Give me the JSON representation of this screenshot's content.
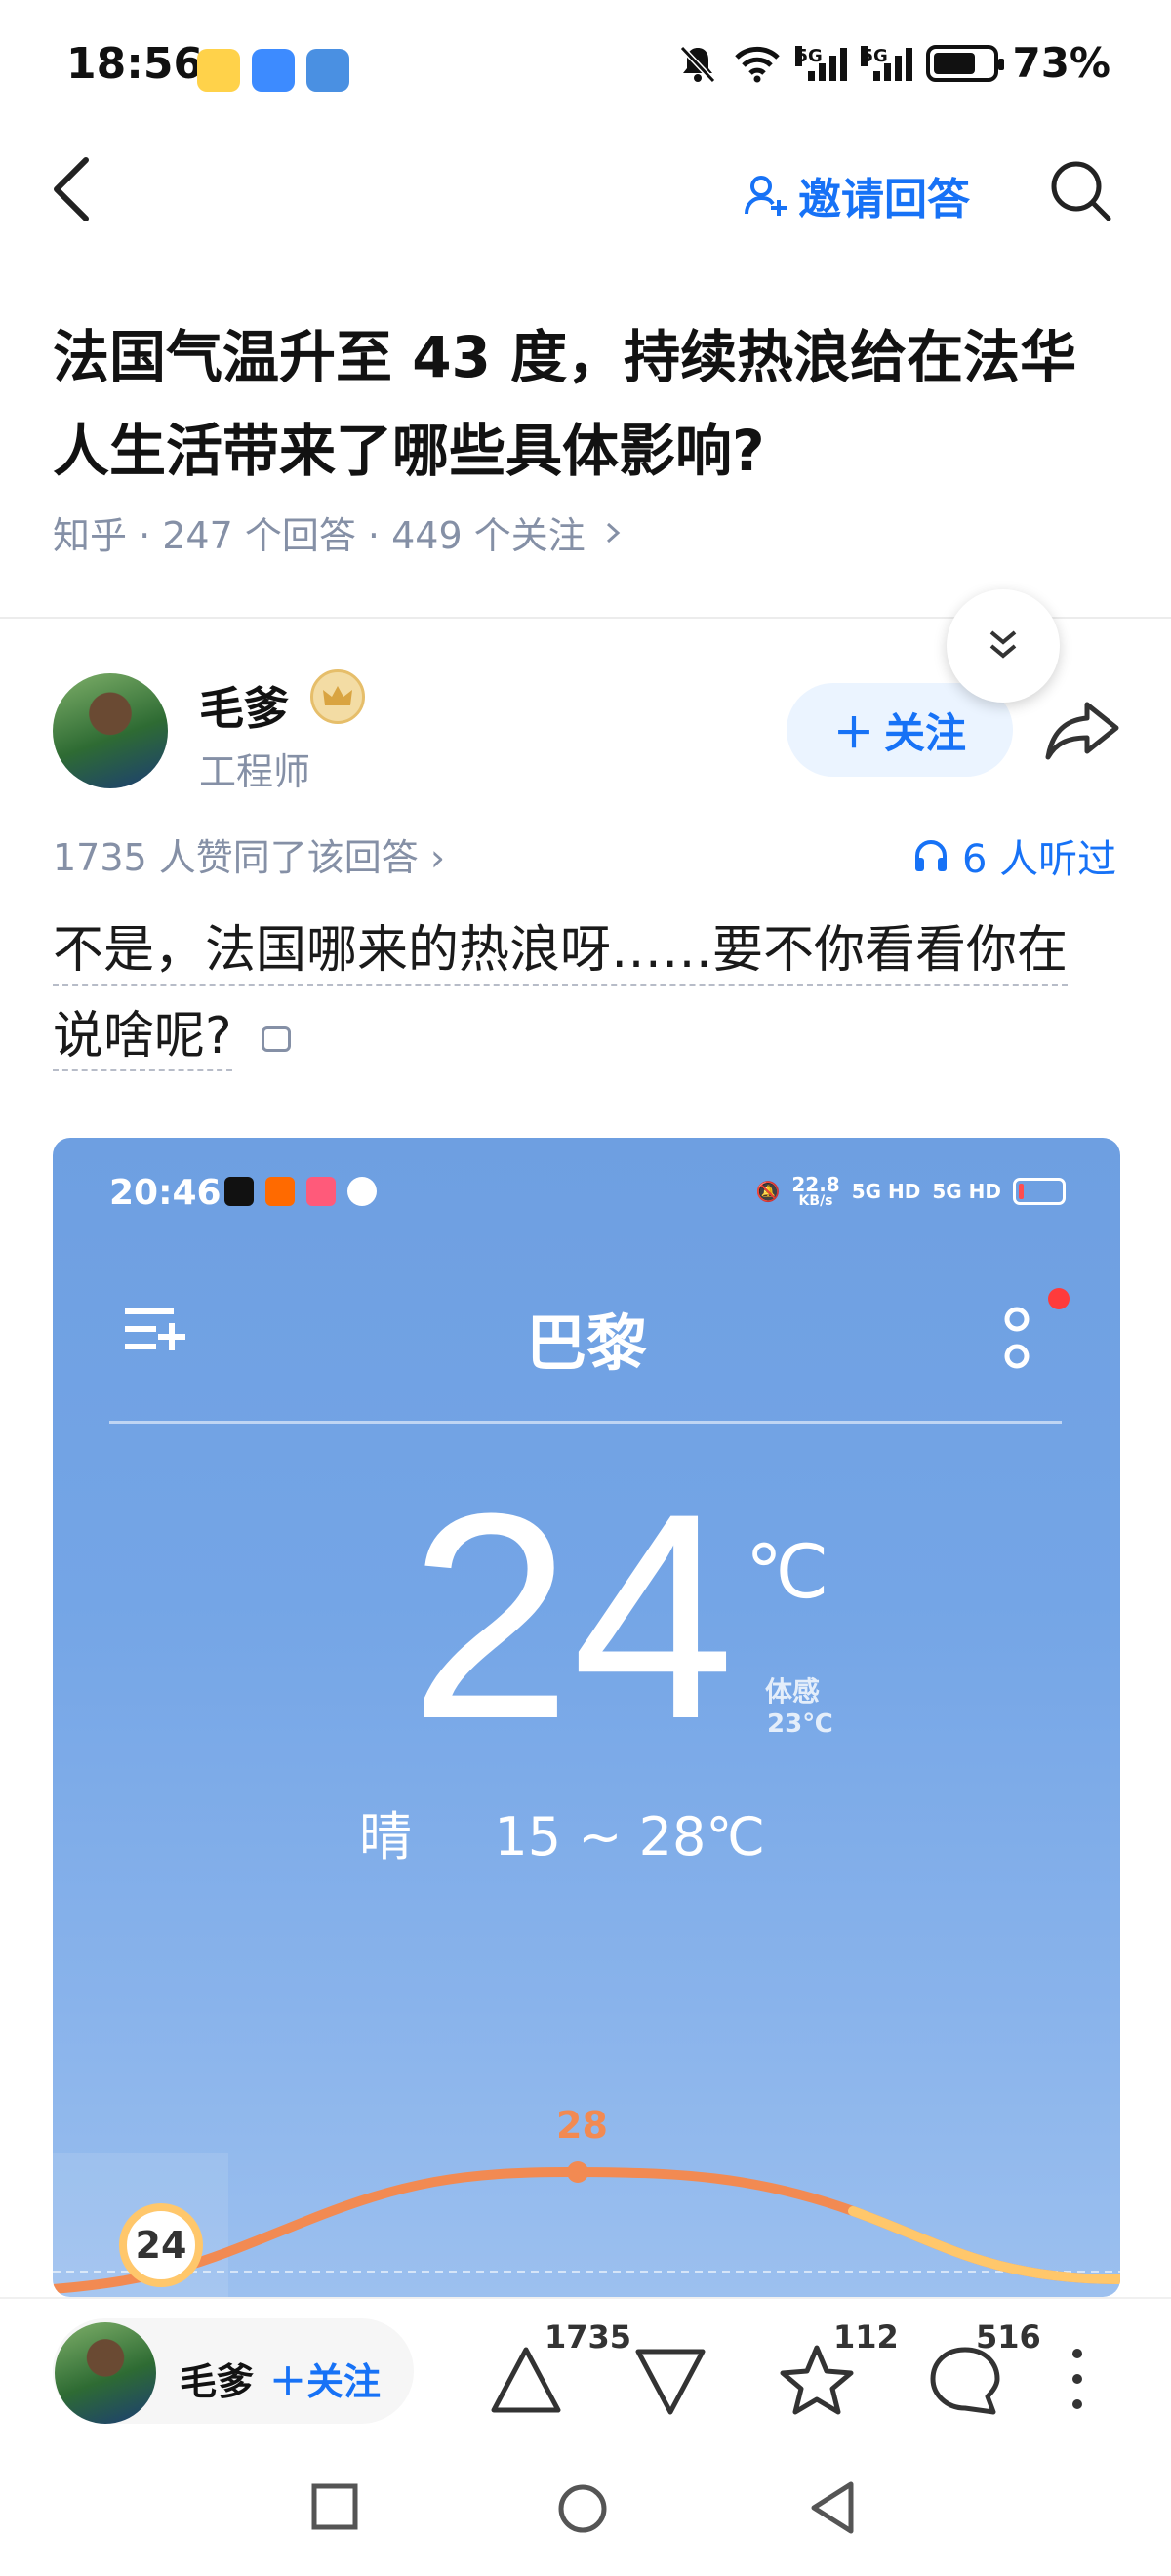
{
  "status_bar": {
    "time": "18:56",
    "network_1": "5G",
    "network_2": "5G",
    "battery": "73%",
    "icons": [
      "weibo-icon",
      "chat-icon",
      "security-icon",
      "mute-icon",
      "wifi-icon"
    ]
  },
  "header": {
    "invite_label": "邀请回答"
  },
  "question": {
    "title": "法国气温升至 43 度，持续热浪给在法华人生活带来了哪些具体影响?",
    "meta": "知乎 · 247 个回答 · 449 个关注"
  },
  "author": {
    "name": "毛爹",
    "title": "工程师",
    "follow_label": "关注"
  },
  "answer": {
    "upvote_info": "1735 人赞同了该回答",
    "listen_info": "6 人听过",
    "text_line1": "不是，法国哪来的热浪呀……要不你看看你在",
    "text_line2": "说啥呢?"
  },
  "weather_screenshot": {
    "time": "20:46",
    "speed": "22.8",
    "speed_unit": "KB/s",
    "net": "5G HD",
    "city": "巴黎",
    "temperature": "24",
    "unit": "℃",
    "feels_label": "体感",
    "feels_value": "23℃",
    "condition": "晴",
    "range": "15 ~ 28℃",
    "peak": "28",
    "start": "24",
    "accent": "#f28a52"
  },
  "bottom_bar": {
    "name": "毛爹",
    "follow_label": "关注",
    "upvotes": "1735",
    "favorites": "112",
    "comments": "516"
  },
  "colors": {
    "brand_blue": "#1772f6",
    "meta_gray": "#8590a6"
  }
}
